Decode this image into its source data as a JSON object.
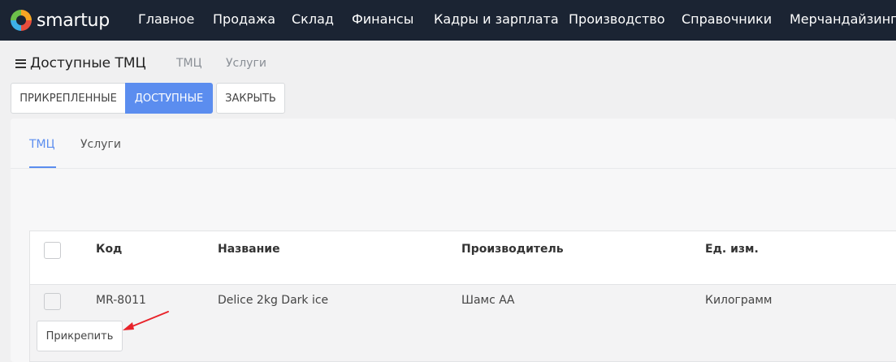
{
  "brand": {
    "name": "smartup"
  },
  "nav": {
    "items": [
      {
        "label": "Главное"
      },
      {
        "label": "Продажа"
      },
      {
        "label": "Склад"
      },
      {
        "label": "Финансы"
      },
      {
        "label": "Кадры и зарплата"
      },
      {
        "label": "Производство"
      },
      {
        "label": "Справочники"
      },
      {
        "label": "Мерчандайзинг"
      }
    ]
  },
  "header": {
    "title": "Доступные ТМЦ",
    "tabs": [
      {
        "label": "ТМЦ"
      },
      {
        "label": "Услуги"
      }
    ]
  },
  "toolbar": {
    "attached_label": "Прикрепленные",
    "available_label": "Доступные",
    "close_label": "Закрыть"
  },
  "content": {
    "tabs": [
      {
        "label": "ТМЦ",
        "active": true
      },
      {
        "label": "Услуги",
        "active": false
      }
    ]
  },
  "table": {
    "columns": [
      "Код",
      "Название",
      "Производитель",
      "Ед. изм."
    ],
    "rows": [
      {
        "code": "MR-8011",
        "name": "Delice 2kg Dark ice",
        "manufacturer": "Шамс АА",
        "unit": "Килограмм"
      }
    ],
    "attach_label": "Прикрепить"
  },
  "colors": {
    "accent": "#5b8def",
    "navbar": "#1b2433",
    "annotation_arrow": "#e8232a"
  }
}
